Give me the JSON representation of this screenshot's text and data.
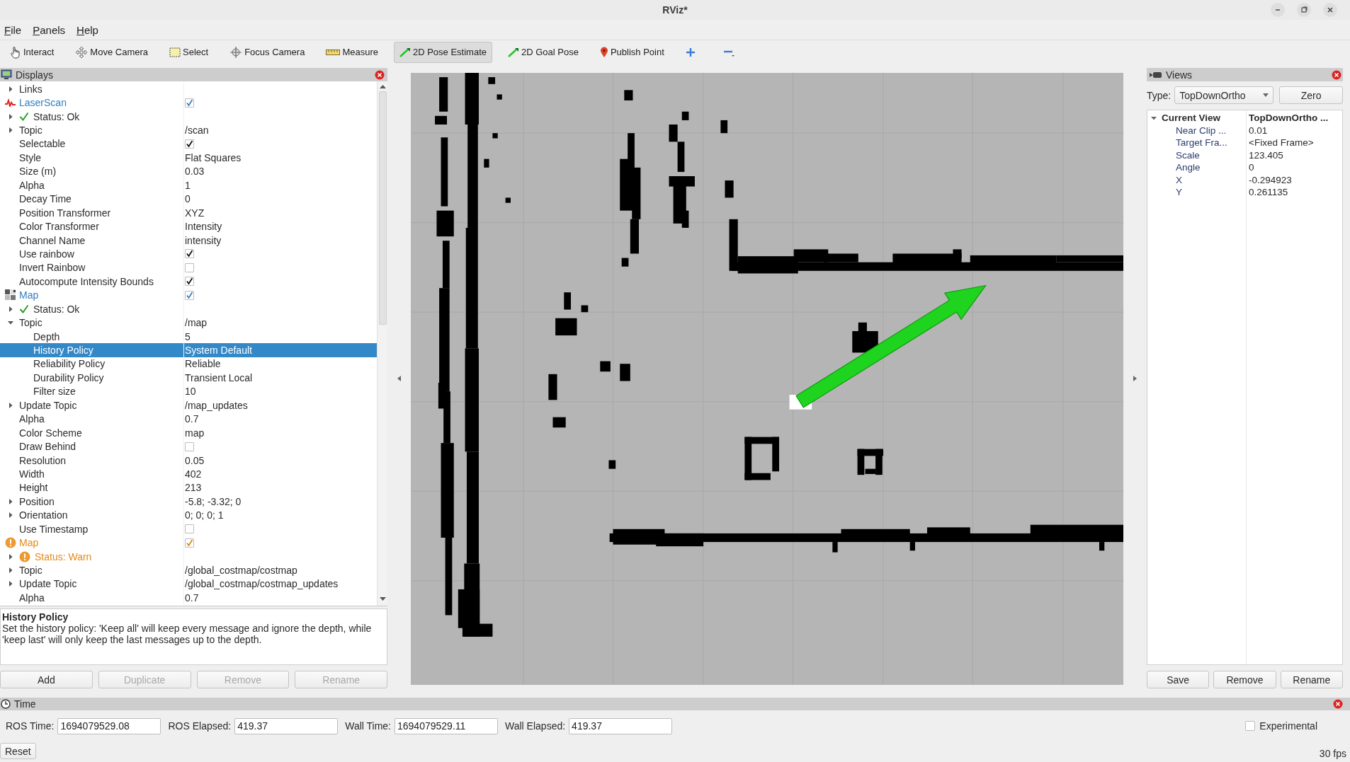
{
  "window": {
    "title": "RViz*"
  },
  "menu": [
    {
      "label": "File"
    },
    {
      "label": "Panels"
    },
    {
      "label": "Help"
    }
  ],
  "toolbar": {
    "tools": [
      {
        "label": "Interact",
        "selected": false
      },
      {
        "label": "Move Camera",
        "selected": false
      },
      {
        "label": "Select",
        "selected": false
      },
      {
        "label": "Focus Camera",
        "selected": false
      },
      {
        "label": "Measure",
        "selected": false
      },
      {
        "label": "2D Pose Estimate",
        "selected": true
      },
      {
        "label": "2D Goal Pose",
        "selected": false
      },
      {
        "label": "Publish Point",
        "selected": false
      }
    ]
  },
  "displays": {
    "title": "Displays",
    "rows": [
      {
        "name": "Links",
        "kind": "property",
        "expanded": false,
        "selected": false
      },
      {
        "name": "LaserScan",
        "kind": "laserscan",
        "warning": false,
        "checked": true,
        "selected": false,
        "children": [
          {
            "name": "Status: Ok",
            "kind": "status",
            "warning": false,
            "expanded": false,
            "selected": false
          },
          {
            "name": "Topic",
            "value": "/scan",
            "kind": "property",
            "expanded": false,
            "selected": false
          },
          {
            "name": "Selectable",
            "kind": "property",
            "checked": true,
            "selected": false
          },
          {
            "name": "Style",
            "value": "Flat Squares",
            "kind": "property",
            "selected": false
          },
          {
            "name": "Size (m)",
            "value": "0.03",
            "kind": "property",
            "selected": false
          },
          {
            "name": "Alpha",
            "value": "1",
            "kind": "property",
            "selected": false
          },
          {
            "name": "Decay Time",
            "value": "0",
            "kind": "property",
            "selected": false
          },
          {
            "name": "Position Transformer",
            "value": "XYZ",
            "kind": "property",
            "selected": false
          },
          {
            "name": "Color Transformer",
            "value": "Intensity",
            "kind": "property",
            "selected": false
          },
          {
            "name": "Channel Name",
            "value": "intensity",
            "kind": "property",
            "selected": false
          },
          {
            "name": "Use rainbow",
            "kind": "property",
            "checked": true,
            "selected": false
          },
          {
            "name": "Invert Rainbow",
            "kind": "property",
            "checked": false,
            "selected": false
          },
          {
            "name": "Autocompute Intensity Bounds",
            "kind": "property",
            "checked": true,
            "selected": false
          }
        ]
      },
      {
        "name": "Map",
        "kind": "map",
        "warning": false,
        "checked": true,
        "selected": false,
        "children": [
          {
            "name": "Status: Ok",
            "kind": "status",
            "warning": false,
            "expanded": false,
            "selected": false
          },
          {
            "name": "Topic",
            "value": "/map",
            "kind": "property",
            "expanded": true,
            "selected": false,
            "children": [
              {
                "name": "Depth",
                "value": "5",
                "kind": "property",
                "selected": false
              },
              {
                "name": "History Policy",
                "value": "System Default",
                "kind": "property",
                "selected": true
              },
              {
                "name": "Reliability Policy",
                "value": "Reliable",
                "kind": "property",
                "selected": false
              },
              {
                "name": "Durability Policy",
                "value": "Transient Local",
                "kind": "property",
                "selected": false
              },
              {
                "name": "Filter size",
                "value": "10",
                "kind": "property",
                "selected": false
              }
            ]
          },
          {
            "name": "Update Topic",
            "value": "/map_updates",
            "kind": "property",
            "expanded": false,
            "selected": false
          },
          {
            "name": "Alpha",
            "value": "0.7",
            "kind": "property",
            "selected": false
          },
          {
            "name": "Color Scheme",
            "value": "map",
            "kind": "property",
            "selected": false
          },
          {
            "name": "Draw Behind",
            "kind": "property",
            "checked": false,
            "selected": false
          },
          {
            "name": "Resolution",
            "value": "0.05",
            "kind": "property",
            "selected": false
          },
          {
            "name": "Width",
            "value": "402",
            "kind": "property",
            "selected": false
          },
          {
            "name": "Height",
            "value": "213",
            "kind": "property",
            "selected": false
          },
          {
            "name": "Position",
            "value": "-5.8; -3.32; 0",
            "kind": "property",
            "expanded": false,
            "selected": false
          },
          {
            "name": "Orientation",
            "value": "0; 0; 0; 1",
            "kind": "property",
            "expanded": false,
            "selected": false
          },
          {
            "name": "Use Timestamp",
            "kind": "property",
            "checked": false,
            "selected": false
          }
        ]
      },
      {
        "name": "Map",
        "kind": "map",
        "warning": true,
        "checked": true,
        "selected": false,
        "children": [
          {
            "name": "Status: Warn",
            "kind": "status",
            "warning": true,
            "expanded": false,
            "selected": false
          },
          {
            "name": "Topic",
            "value": "/global_costmap/costmap",
            "kind": "property",
            "expanded": false,
            "selected": false
          },
          {
            "name": "Update Topic",
            "value": "/global_costmap/costmap_updates",
            "kind": "property",
            "expanded": false,
            "selected": false
          },
          {
            "name": "Alpha",
            "value": "0.7",
            "kind": "property",
            "selected": false
          }
        ]
      }
    ],
    "description": {
      "title": "History Policy",
      "text": "Set the history policy: 'Keep all' will keep every message and ignore the depth, while 'keep last' will only keep the last messages up to the depth."
    },
    "buttons": [
      {
        "label": "Add",
        "disabled": false
      },
      {
        "label": "Duplicate",
        "disabled": true
      },
      {
        "label": "Remove",
        "disabled": true
      },
      {
        "label": "Rename",
        "disabled": true
      }
    ]
  },
  "views": {
    "title": "Views",
    "type_label": "Type:",
    "type_value": "TopDownOrtho",
    "zero_button": "Zero",
    "rows": [
      {
        "name": "Current View",
        "value": "TopDownOrtho ...",
        "expanded": true,
        "selected": false,
        "children": [
          {
            "name": "Near Clip ...",
            "value": "0.01",
            "selected": false
          },
          {
            "name": "Target Fra...",
            "value": "<Fixed Frame>",
            "selected": false
          },
          {
            "name": "Scale",
            "value": "123.405",
            "selected": false
          },
          {
            "name": "Angle",
            "value": "0",
            "selected": false
          },
          {
            "name": "X",
            "value": "-0.294923",
            "selected": false
          },
          {
            "name": "Y",
            "value": "0.261135",
            "selected": false
          }
        ]
      }
    ],
    "buttons": [
      "Save",
      "Remove",
      "Rename"
    ]
  },
  "time": {
    "title": "Time",
    "fields": [
      {
        "label": "ROS Time:",
        "value": "1694079529.08"
      },
      {
        "label": "ROS Elapsed:",
        "value": "419.37"
      },
      {
        "label": "Wall Time:",
        "value": "1694079529.11"
      },
      {
        "label": "Wall Elapsed:",
        "value": "419.37"
      }
    ],
    "experimental": {
      "label": "Experimental",
      "checked": false
    },
    "reset": "Reset",
    "fps": "30 fps"
  }
}
